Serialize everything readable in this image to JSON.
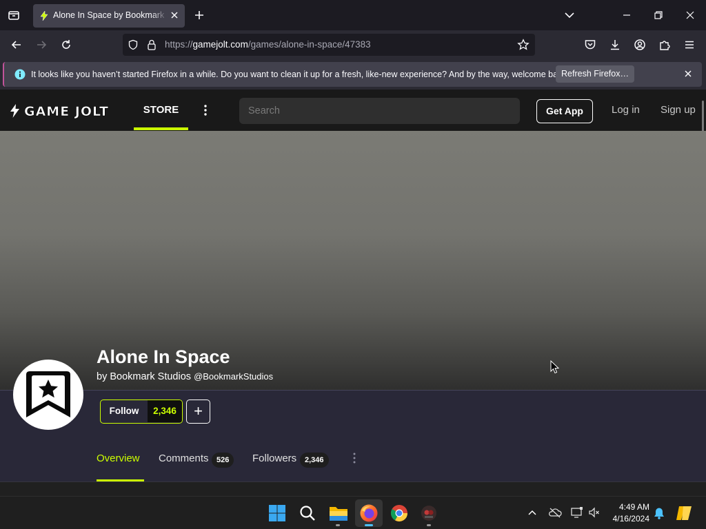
{
  "browser": {
    "tab_title": "Alone In Space by Bookmark Studios",
    "url_prefix": "https://",
    "url_host": "gamejolt.com",
    "url_path": "/games/alone-in-space/47383"
  },
  "notification": {
    "message": "It looks like you haven’t started Firefox in a while. Do you want to clean it up for a fresh, like-new experience? And by the way, welcome back!",
    "button_label": "Refresh Firefox…"
  },
  "site_header": {
    "logo_text": "GAME JOLT",
    "store_label": "STORE",
    "search_placeholder": "Search",
    "get_app_label": "Get App",
    "login_label": "Log in",
    "signup_label": "Sign up"
  },
  "game": {
    "title": "Alone In Space",
    "by_prefix": "by",
    "developer": "Bookmark Studios",
    "handle": "@BookmarkStudios",
    "follow_label": "Follow",
    "follower_count": "2,346",
    "plus_label": "+"
  },
  "tabs": {
    "overview": "Overview",
    "comments": "Comments",
    "comments_count": "526",
    "followers": "Followers",
    "followers_count": "2,346"
  },
  "taskbar": {
    "time": "4:49 AM",
    "date": "4/16/2024"
  },
  "colors": {
    "accent": "#ccff00",
    "browser_bg": "#1c1b22",
    "site_header_bg": "#191919",
    "content_bg": "#292838"
  }
}
